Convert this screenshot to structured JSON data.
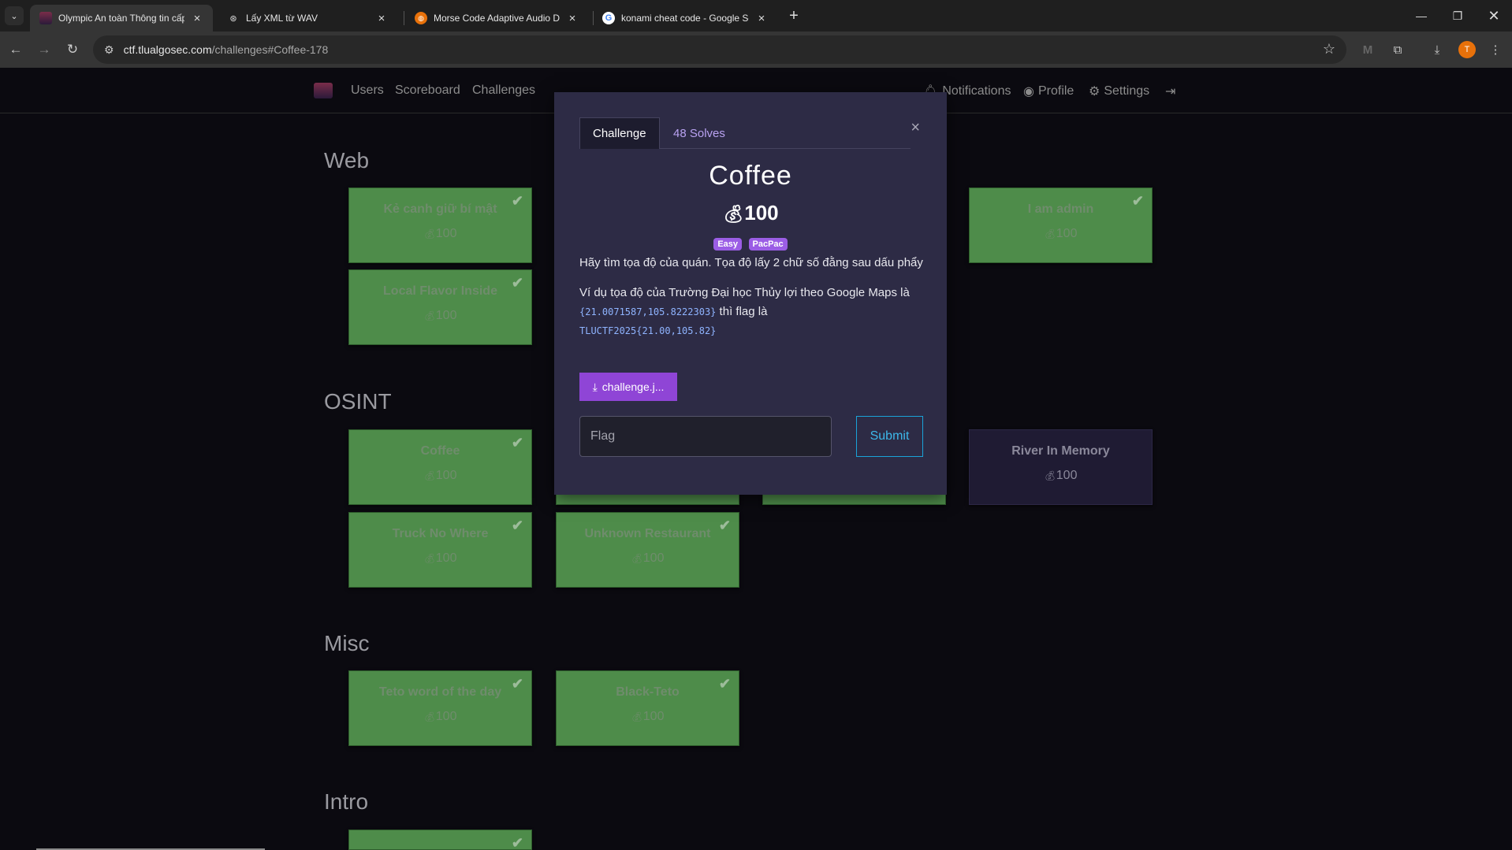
{
  "browser": {
    "tabs": [
      {
        "title": "Olympic An toàn Thông tin cấp",
        "active": true
      },
      {
        "title": "Lấy XML từ WAV",
        "active": false
      },
      {
        "title": "Morse Code Adaptive Audio De",
        "active": false
      },
      {
        "title": "konami cheat code - Google Se",
        "active": false
      }
    ],
    "url_host": "ctf.tlualgosec.com",
    "url_path": "/challenges#Coffee-178",
    "profile_initial": "T"
  },
  "nav": {
    "users": "Users",
    "scoreboard": "Scoreboard",
    "challenges": "Challenges",
    "notifications": "Notifications",
    "profile": "Profile",
    "settings": "Settings"
  },
  "board": {
    "categories": [
      "Web",
      "OSINT",
      "Misc",
      "Intro"
    ],
    "cards": [
      {
        "name": "Kẻ canh giữ bí mật",
        "value": "100",
        "solved": true
      },
      {
        "name": "I am admin",
        "value": "100",
        "solved": true
      },
      {
        "name": "Local Flavor Inside",
        "value": "100",
        "solved": true
      },
      {
        "name": "Coffee",
        "value": "100",
        "solved": true
      },
      {
        "name": "River In Memory",
        "value": "100",
        "solved": false
      },
      {
        "name": "Truck No Where",
        "value": "100",
        "solved": true
      },
      {
        "name": "Unknown Restaurant",
        "value": "100",
        "solved": true
      },
      {
        "name": "Teto word of the day",
        "value": "100",
        "solved": true
      },
      {
        "name": "Black-Teto",
        "value": "100",
        "solved": true
      }
    ]
  },
  "modal": {
    "tab_challenge": "Challenge",
    "tab_solves": "48 Solves",
    "close": "×",
    "title": "Coffee",
    "value": "100",
    "tags": [
      "Easy",
      "PacPac"
    ],
    "desc_1": "Hãy tìm tọa độ của quán. Tọa độ lấy 2 chữ số đằng sau dấu phẩy",
    "desc_2_a": "Ví dụ tọa độ của Trường Đại học Thủy lợi theo Google Maps là ",
    "desc_2_code": "{21.0071587,105.8222303}",
    "desc_2_b": " thì flag là",
    "desc_2_flag": "TLUCTF2025{21.00,105.82}",
    "file_label": "challenge.j...",
    "flag_placeholder": "Flag",
    "submit": "Submit"
  }
}
